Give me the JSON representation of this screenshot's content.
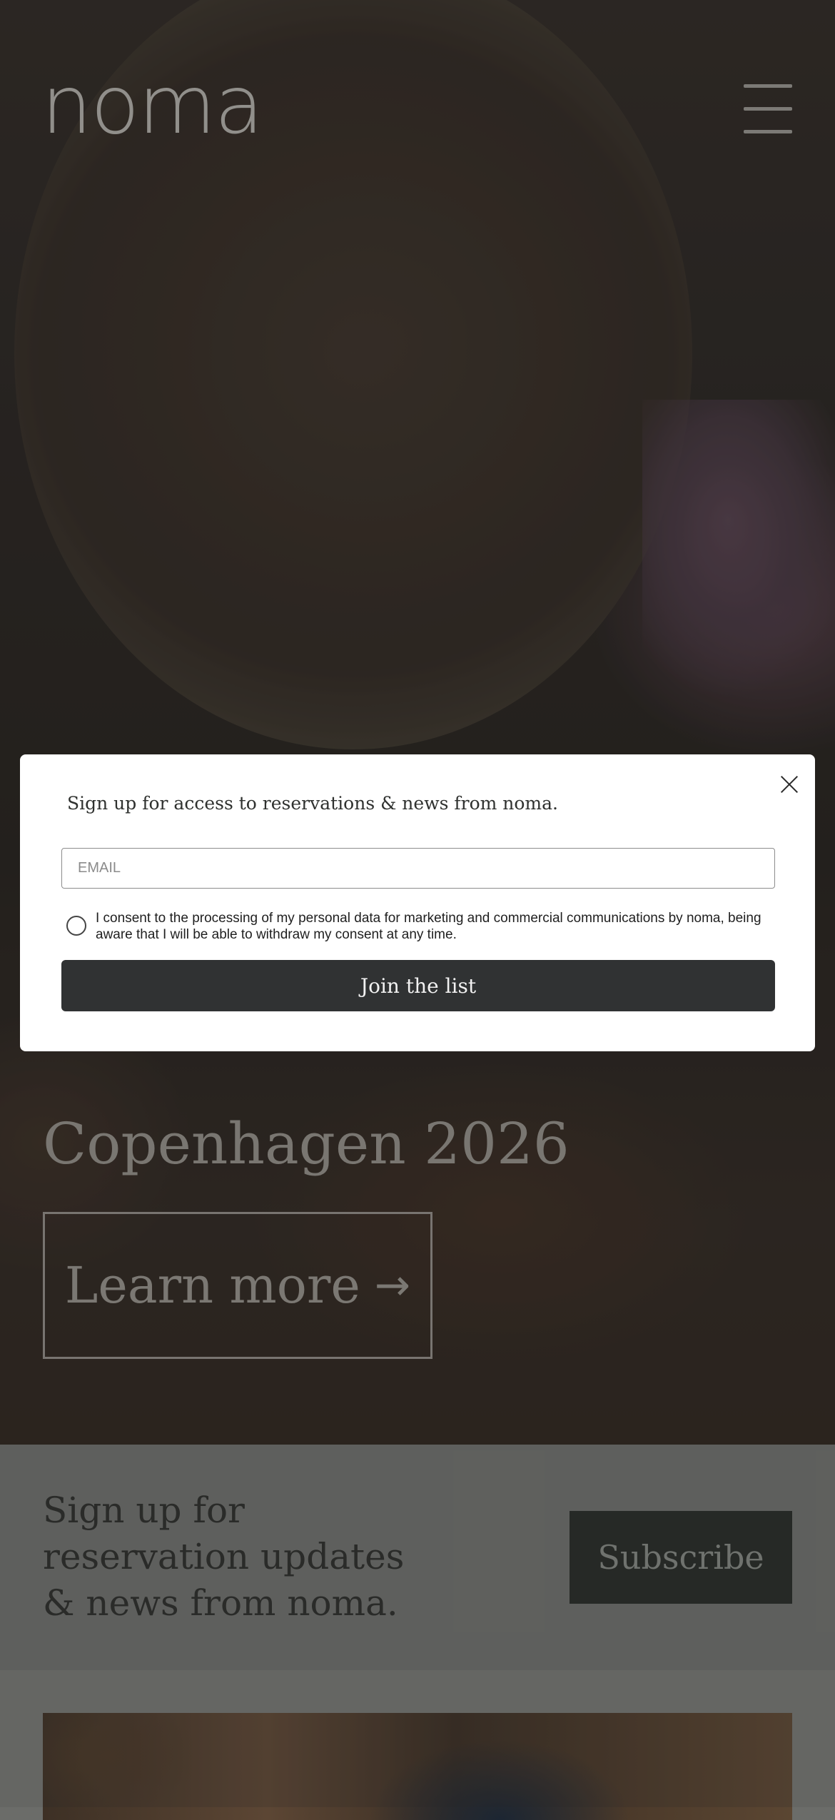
{
  "brand": {
    "logo_text": "noma"
  },
  "hero": {
    "title": "Copenhagen 2026",
    "cta_label": "Learn more",
    "cta_arrow": "→"
  },
  "signup_band": {
    "text": "Sign up for reservation updates & news from noma.",
    "button_label": "Subscribe"
  },
  "modal": {
    "title": "Sign up for access to reservations & news from noma.",
    "email_placeholder": "EMAIL",
    "email_value": "",
    "consent_text": "I consent to the processing of my personal data for marketing and commercial communications by noma, being aware that I will be able to withdraw my consent at any time.",
    "consent_checked": false,
    "submit_label": "Join the list"
  },
  "icons": {
    "menu": "hamburger-menu-icon",
    "close": "close-icon",
    "arrow": "arrow-right-icon"
  }
}
